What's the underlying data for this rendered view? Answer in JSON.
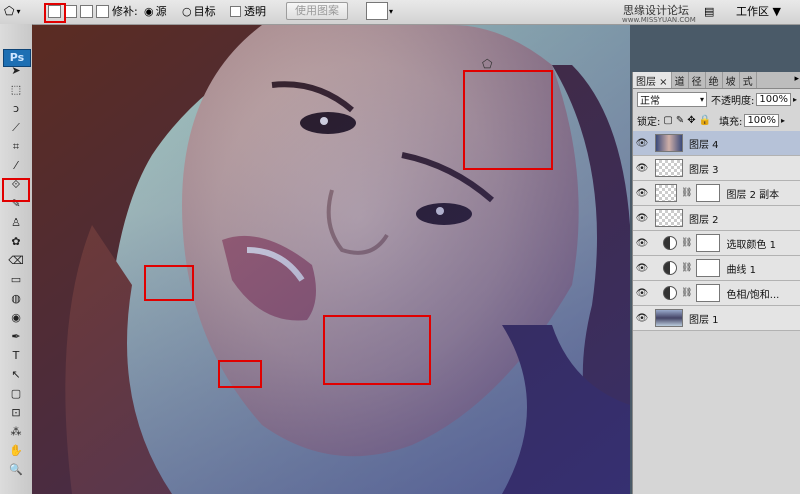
{
  "options": {
    "repair_label": "修补:",
    "source_label": "源",
    "target_label": "目标",
    "transparent_label": "透明",
    "use_pattern_label": "使用图案",
    "watermark": "思缘设计论坛",
    "watermark_url": "www.MISSYUAN.COM",
    "workspace_label": "工作区 ▼"
  },
  "toolbar": {
    "logo": "Ps",
    "tools": [
      "➤",
      "⬚",
      "ↄ",
      "⟋",
      "⌗",
      "⁄",
      "⟐",
      "✎",
      "♙",
      "✿",
      "⌫",
      "▭",
      "◍",
      "◉",
      "✒",
      "T",
      "↖",
      "▢",
      "⊡",
      "⁂",
      "✋",
      "🔍"
    ]
  },
  "layers_panel": {
    "tabs": [
      "图层 ×",
      "道",
      "径",
      "绝",
      "坡",
      "式"
    ],
    "blend_mode": "正常",
    "opacity_label": "不透明度:",
    "opacity_value": "100%",
    "lock_label": "锁定:",
    "fill_label": "填充:",
    "fill_value": "100%",
    "layers": [
      {
        "name": "图层 4",
        "selected": true
      },
      {
        "name": "图层 3",
        "selected": false
      },
      {
        "name": "图层 2 副本",
        "selected": false
      },
      {
        "name": "图层 2",
        "selected": false
      },
      {
        "name": "选取颜色 1",
        "selected": false
      },
      {
        "name": "曲线 1",
        "selected": false
      },
      {
        "name": "色相/饱和...",
        "selected": false
      },
      {
        "name": "图层 1",
        "selected": false
      }
    ]
  }
}
